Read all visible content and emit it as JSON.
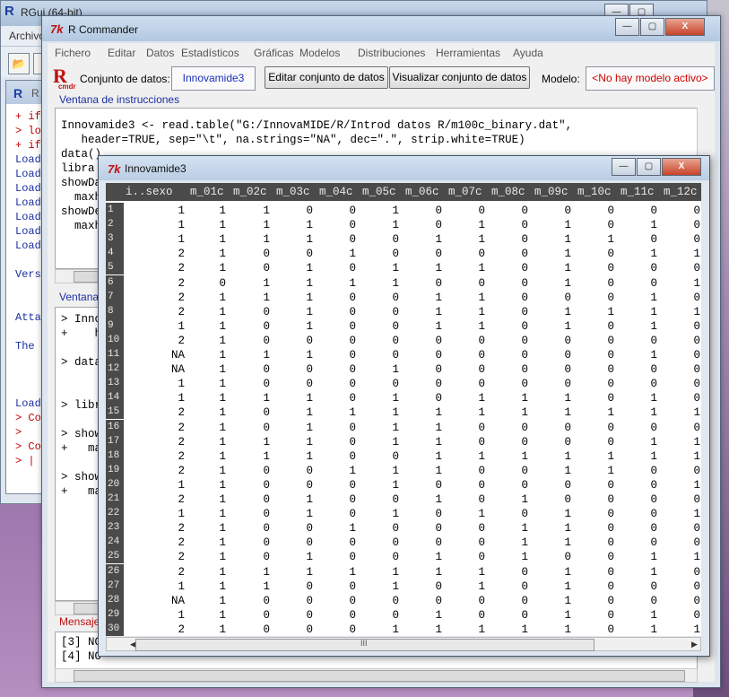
{
  "rgui": {
    "title": "RGui (64-bit)",
    "menu_first": "Archivo",
    "console_title": "R C",
    "console_lines": [
      {
        "text": "+ if",
        "cls": "red"
      },
      {
        "text": "> lo",
        "cls": "red"
      },
      {
        "text": "+ if",
        "cls": "red"
      },
      {
        "text": "Load",
        "cls": "blue"
      },
      {
        "text": "Load",
        "cls": "blue"
      },
      {
        "text": "Load",
        "cls": "blue"
      },
      {
        "text": "Load",
        "cls": "blue"
      },
      {
        "text": "Load",
        "cls": "blue"
      },
      {
        "text": "Load",
        "cls": "blue"
      },
      {
        "text": "Load",
        "cls": "blue"
      },
      {
        "text": "",
        "cls": "blue"
      },
      {
        "text": "Vers",
        "cls": "blue"
      },
      {
        "text": "",
        "cls": "blue"
      },
      {
        "text": "",
        "cls": "blue"
      },
      {
        "text": "Atta",
        "cls": "blue"
      },
      {
        "text": "",
        "cls": "blue"
      },
      {
        "text": "The ",
        "cls": "blue"
      },
      {
        "text": "",
        "cls": "blue"
      },
      {
        "text": "",
        "cls": "blue"
      },
      {
        "text": "",
        "cls": "blue"
      },
      {
        "text": "Load",
        "cls": "blue"
      },
      {
        "text": "> Co",
        "cls": "red"
      },
      {
        "text": ">",
        "cls": "red"
      },
      {
        "text": "> Co",
        "cls": "red"
      },
      {
        "text": "> |",
        "cls": "red"
      }
    ]
  },
  "rcmdr": {
    "title": "R Commander",
    "menu": [
      "Fichero",
      "Editar",
      "Datos",
      "Estadísticos",
      "Gráficas",
      "Modelos",
      "Distribuciones",
      "Herramientas",
      "Ayuda"
    ],
    "dataset_label": "Conjunto de datos:",
    "dataset_value": "Innovamide3",
    "edit_button": "Editar conjunto de datos",
    "view_button": "Visualizar conjunto de datos",
    "model_label": "Modelo:",
    "model_value": "<No hay modelo activo>",
    "instructions_label": "Ventana de instrucciones",
    "instructions": [
      "Innovamide3 <- read.table(\"G:/InnovaMIDE/R/Introd datos R/m100c_binary.dat\",",
      "   header=TRUE, sep=\"\\t\", na.strings=\"NA\", dec=\".\", strip.white=TRUE)",
      "data()",
      "libra",
      "showDa",
      "  maxh",
      "showDe",
      "  maxh"
    ],
    "output_label": "Ventana",
    "output_lines": [
      {
        "text": "> Inno",
        "cls": "red"
      },
      {
        "text": "+    h",
        "cls": "red"
      },
      {
        "text": "",
        "cls": "red"
      },
      {
        "text": "> data",
        "cls": "red"
      },
      {
        "text": "",
        "cls": "red"
      },
      {
        "text": "",
        "cls": "red"
      },
      {
        "text": "> libr",
        "cls": "red"
      },
      {
        "text": "",
        "cls": "red"
      },
      {
        "text": "> show",
        "cls": "red"
      },
      {
        "text": "+   ma",
        "cls": "red"
      },
      {
        "text": "",
        "cls": "red"
      },
      {
        "text": "> show",
        "cls": "red"
      },
      {
        "text": "+   ma",
        "cls": "red"
      }
    ],
    "messages_label": "Mensaje",
    "messages": [
      "[3] NO",
      "[4] NO"
    ]
  },
  "data_window": {
    "title": "Innovamide3",
    "columns": [
      "i..sexo",
      "m_01c",
      "m_02c",
      "m_03c",
      "m_04c",
      "m_05c",
      "m_06c",
      "m_07c",
      "m_08c",
      "m_09c",
      "m_10c",
      "m_11c",
      "m_12c"
    ],
    "rows": [
      [
        "1",
        "1",
        "1",
        "0",
        "0",
        "1",
        "0",
        "0",
        "0",
        "0",
        "0",
        "0",
        "0"
      ],
      [
        "1",
        "1",
        "1",
        "1",
        "0",
        "1",
        "0",
        "1",
        "0",
        "1",
        "0",
        "1",
        "0"
      ],
      [
        "1",
        "1",
        "1",
        "1",
        "0",
        "0",
        "1",
        "1",
        "0",
        "1",
        "1",
        "0",
        "0"
      ],
      [
        "2",
        "1",
        "0",
        "0",
        "1",
        "0",
        "0",
        "0",
        "0",
        "1",
        "0",
        "1",
        "1"
      ],
      [
        "2",
        "1",
        "0",
        "1",
        "0",
        "1",
        "1",
        "1",
        "0",
        "1",
        "0",
        "0",
        "0"
      ],
      [
        "2",
        "0",
        "1",
        "1",
        "1",
        "1",
        "0",
        "0",
        "0",
        "1",
        "0",
        "0",
        "1"
      ],
      [
        "2",
        "1",
        "1",
        "1",
        "0",
        "0",
        "1",
        "1",
        "0",
        "0",
        "0",
        "1",
        "0"
      ],
      [
        "2",
        "1",
        "0",
        "1",
        "0",
        "0",
        "1",
        "1",
        "0",
        "1",
        "1",
        "1",
        "1"
      ],
      [
        "1",
        "1",
        "0",
        "1",
        "0",
        "0",
        "1",
        "1",
        "0",
        "1",
        "0",
        "1",
        "0"
      ],
      [
        "2",
        "1",
        "0",
        "0",
        "0",
        "0",
        "0",
        "0",
        "0",
        "0",
        "0",
        "0",
        "0"
      ],
      [
        "NA",
        "1",
        "1",
        "1",
        "0",
        "0",
        "0",
        "0",
        "0",
        "0",
        "0",
        "1",
        "0"
      ],
      [
        "NA",
        "1",
        "0",
        "0",
        "0",
        "1",
        "0",
        "0",
        "0",
        "0",
        "0",
        "0",
        "0"
      ],
      [
        "1",
        "1",
        "0",
        "0",
        "0",
        "0",
        "0",
        "0",
        "0",
        "0",
        "0",
        "0",
        "0"
      ],
      [
        "1",
        "1",
        "1",
        "1",
        "0",
        "1",
        "0",
        "1",
        "1",
        "1",
        "0",
        "1",
        "0"
      ],
      [
        "2",
        "1",
        "0",
        "1",
        "1",
        "1",
        "1",
        "1",
        "1",
        "1",
        "1",
        "1",
        "1"
      ],
      [
        "2",
        "1",
        "0",
        "1",
        "0",
        "1",
        "1",
        "0",
        "0",
        "0",
        "0",
        "0",
        "0"
      ],
      [
        "2",
        "1",
        "1",
        "1",
        "0",
        "1",
        "1",
        "0",
        "0",
        "0",
        "0",
        "1",
        "1"
      ],
      [
        "2",
        "1",
        "1",
        "1",
        "0",
        "0",
        "1",
        "1",
        "1",
        "1",
        "1",
        "1",
        "1"
      ],
      [
        "2",
        "1",
        "0",
        "0",
        "1",
        "1",
        "1",
        "0",
        "0",
        "1",
        "1",
        "0",
        "0"
      ],
      [
        "1",
        "1",
        "0",
        "0",
        "0",
        "1",
        "0",
        "0",
        "0",
        "0",
        "0",
        "0",
        "1"
      ],
      [
        "2",
        "1",
        "0",
        "1",
        "0",
        "0",
        "1",
        "0",
        "1",
        "0",
        "0",
        "0",
        "0"
      ],
      [
        "1",
        "1",
        "0",
        "1",
        "0",
        "1",
        "0",
        "1",
        "0",
        "1",
        "0",
        "0",
        "1"
      ],
      [
        "2",
        "1",
        "0",
        "0",
        "1",
        "0",
        "0",
        "0",
        "1",
        "1",
        "0",
        "0",
        "0"
      ],
      [
        "2",
        "1",
        "0",
        "0",
        "0",
        "0",
        "0",
        "0",
        "1",
        "1",
        "0",
        "0",
        "0"
      ],
      [
        "2",
        "1",
        "0",
        "1",
        "0",
        "0",
        "1",
        "0",
        "1",
        "0",
        "0",
        "1",
        "1"
      ],
      [
        "2",
        "1",
        "1",
        "1",
        "1",
        "1",
        "1",
        "1",
        "0",
        "1",
        "0",
        "1",
        "0"
      ],
      [
        "1",
        "1",
        "1",
        "0",
        "0",
        "1",
        "0",
        "1",
        "0",
        "1",
        "0",
        "0",
        "0"
      ],
      [
        "NA",
        "1",
        "0",
        "0",
        "0",
        "0",
        "0",
        "0",
        "0",
        "1",
        "0",
        "0",
        "0"
      ],
      [
        "1",
        "1",
        "0",
        "0",
        "0",
        "0",
        "1",
        "0",
        "0",
        "1",
        "0",
        "1",
        "0"
      ],
      [
        "2",
        "1",
        "0",
        "0",
        "0",
        "1",
        "1",
        "1",
        "1",
        "1",
        "0",
        "1",
        "1"
      ]
    ]
  },
  "icons": {
    "minimize": "—",
    "maximize": "▢",
    "close": "X",
    "tk_logo": "7k",
    "r_logo": "R",
    "left_arrow": "◀",
    "right_arrow": "▶",
    "grip": "III"
  }
}
